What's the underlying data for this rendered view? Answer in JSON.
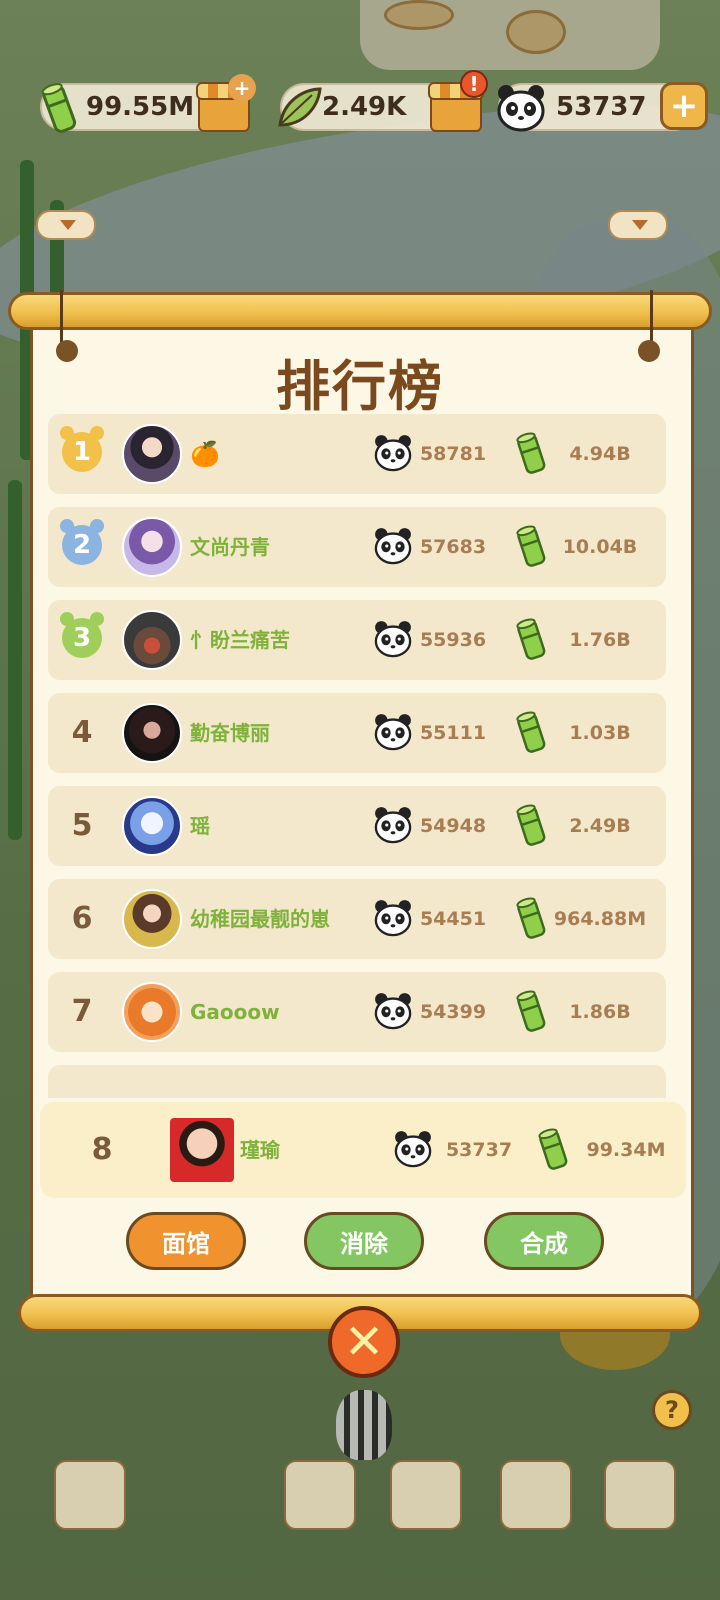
{
  "resources": {
    "bamboo": "99.55M",
    "leaf": "2.49K",
    "panda": "53737"
  },
  "panel": {
    "title": "排行榜"
  },
  "rows": [
    {
      "rank": "1",
      "name": "",
      "emoji": "🍊",
      "score": "58781",
      "bamboo": "4.94B",
      "medal_color": "#f2c14a"
    },
    {
      "rank": "2",
      "name": "文尚丹青",
      "score": "57683",
      "bamboo": "10.04B",
      "medal_color": "#8cb4e0"
    },
    {
      "rank": "3",
      "name": "忄盼兰痛苦",
      "score": "55936",
      "bamboo": "1.76B",
      "medal_color": "#9fcf5a"
    },
    {
      "rank": "4",
      "name": "勤奋博丽",
      "score": "55111",
      "bamboo": "1.03B"
    },
    {
      "rank": "5",
      "name": "瑶",
      "score": "54948",
      "bamboo": "2.49B"
    },
    {
      "rank": "6",
      "name": "幼稚园最靓的崽",
      "score": "54451",
      "bamboo": "964.88M"
    },
    {
      "rank": "7",
      "name": "Gaooow",
      "score": "54399",
      "bamboo": "1.86B"
    }
  ],
  "self": {
    "rank": "8",
    "name": "瑾瑜",
    "score": "53737",
    "bamboo": "99.34M"
  },
  "tabs": {
    "noodle": "面馆",
    "eliminate": "消除",
    "merge": "合成"
  },
  "icons": {
    "close": "close-icon",
    "panda": "panda-icon",
    "bamboo": "bamboo-icon"
  },
  "colors": {
    "name_green": "#7fb23a",
    "title_brown": "#7a4a1e",
    "accent_orange": "#f0922e"
  }
}
